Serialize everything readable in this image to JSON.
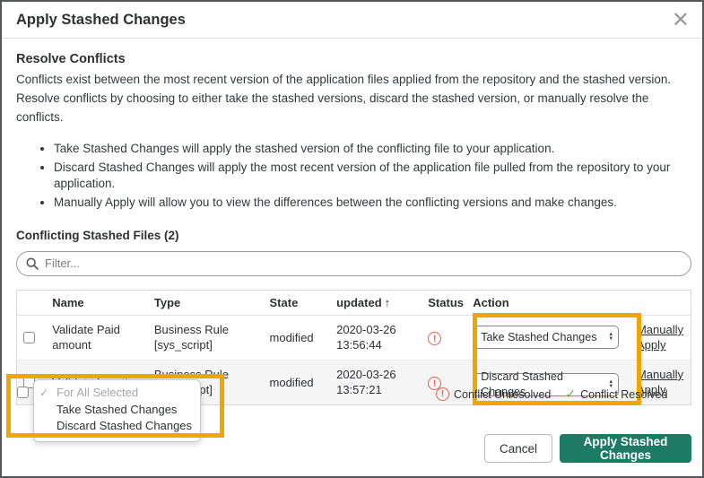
{
  "dialog": {
    "title": "Apply Stashed Changes"
  },
  "icons": {
    "close": "✕",
    "sort_asc": "↑",
    "spinner_up": "▲",
    "spinner_down": "▼",
    "check": "✓",
    "exclaim": "!"
  },
  "intro": {
    "heading": "Resolve Conflicts",
    "description": "Conflicts exist between the most recent version of the application files applied from the repository and the stashed version. Resolve conflicts by choosing to either take the stashed versions, discard the stashed version, or manually resolve the conflicts.",
    "bullets": [
      "Take Stashed Changes will apply the stashed version of the conflicting file to your application.",
      "Discard Stashed Changes will apply the most recent version of the application file pulled from the repository to your application.",
      "Manually Apply will allow you to view the differences between the conflicting versions and make changes."
    ]
  },
  "files": {
    "label": "Conflicting Stashed Files (2)",
    "filter_placeholder": "Filter..."
  },
  "table": {
    "headers": {
      "name": "Name",
      "type": "Type",
      "state": "State",
      "updated": "updated",
      "status": "Status",
      "action": "Action"
    },
    "rows": [
      {
        "name": "Validate Paid amount",
        "type_line1": "Business Rule",
        "type_line2": "[sys_script]",
        "state": "modified",
        "updated_date": "2020-03-26",
        "updated_time": "13:56:44",
        "status": "Conflict Unresolved",
        "action": "Take Stashed Changes",
        "link_line1": "Manually",
        "link_line2": "Apply"
      },
      {
        "name": "Validate Location",
        "type_line1": "Business Rule",
        "type_line2": "[sys_script]",
        "state": "modified",
        "updated_date": "2020-03-26",
        "updated_time": "13:57:21",
        "status": "Conflict Unresolved",
        "action": "Discard Stashed Changes",
        "link_line1": "Manually",
        "link_line2": "Apply"
      }
    ]
  },
  "bulk_menu": {
    "items": [
      "For All Selected",
      "Take Stashed Changes",
      "Discard Stashed Changes"
    ]
  },
  "legend": {
    "unresolved": "Conflict Unresolved",
    "resolved": "Conflict Resolved"
  },
  "footer": {
    "cancel_label": "Cancel",
    "apply_label": "Apply Stashed Changes"
  },
  "colors": {
    "highlight_orange": "#F0A500",
    "primary_green": "#1D7A64",
    "status_red": "#E0614F",
    "resolved_green": "#68A94F"
  }
}
